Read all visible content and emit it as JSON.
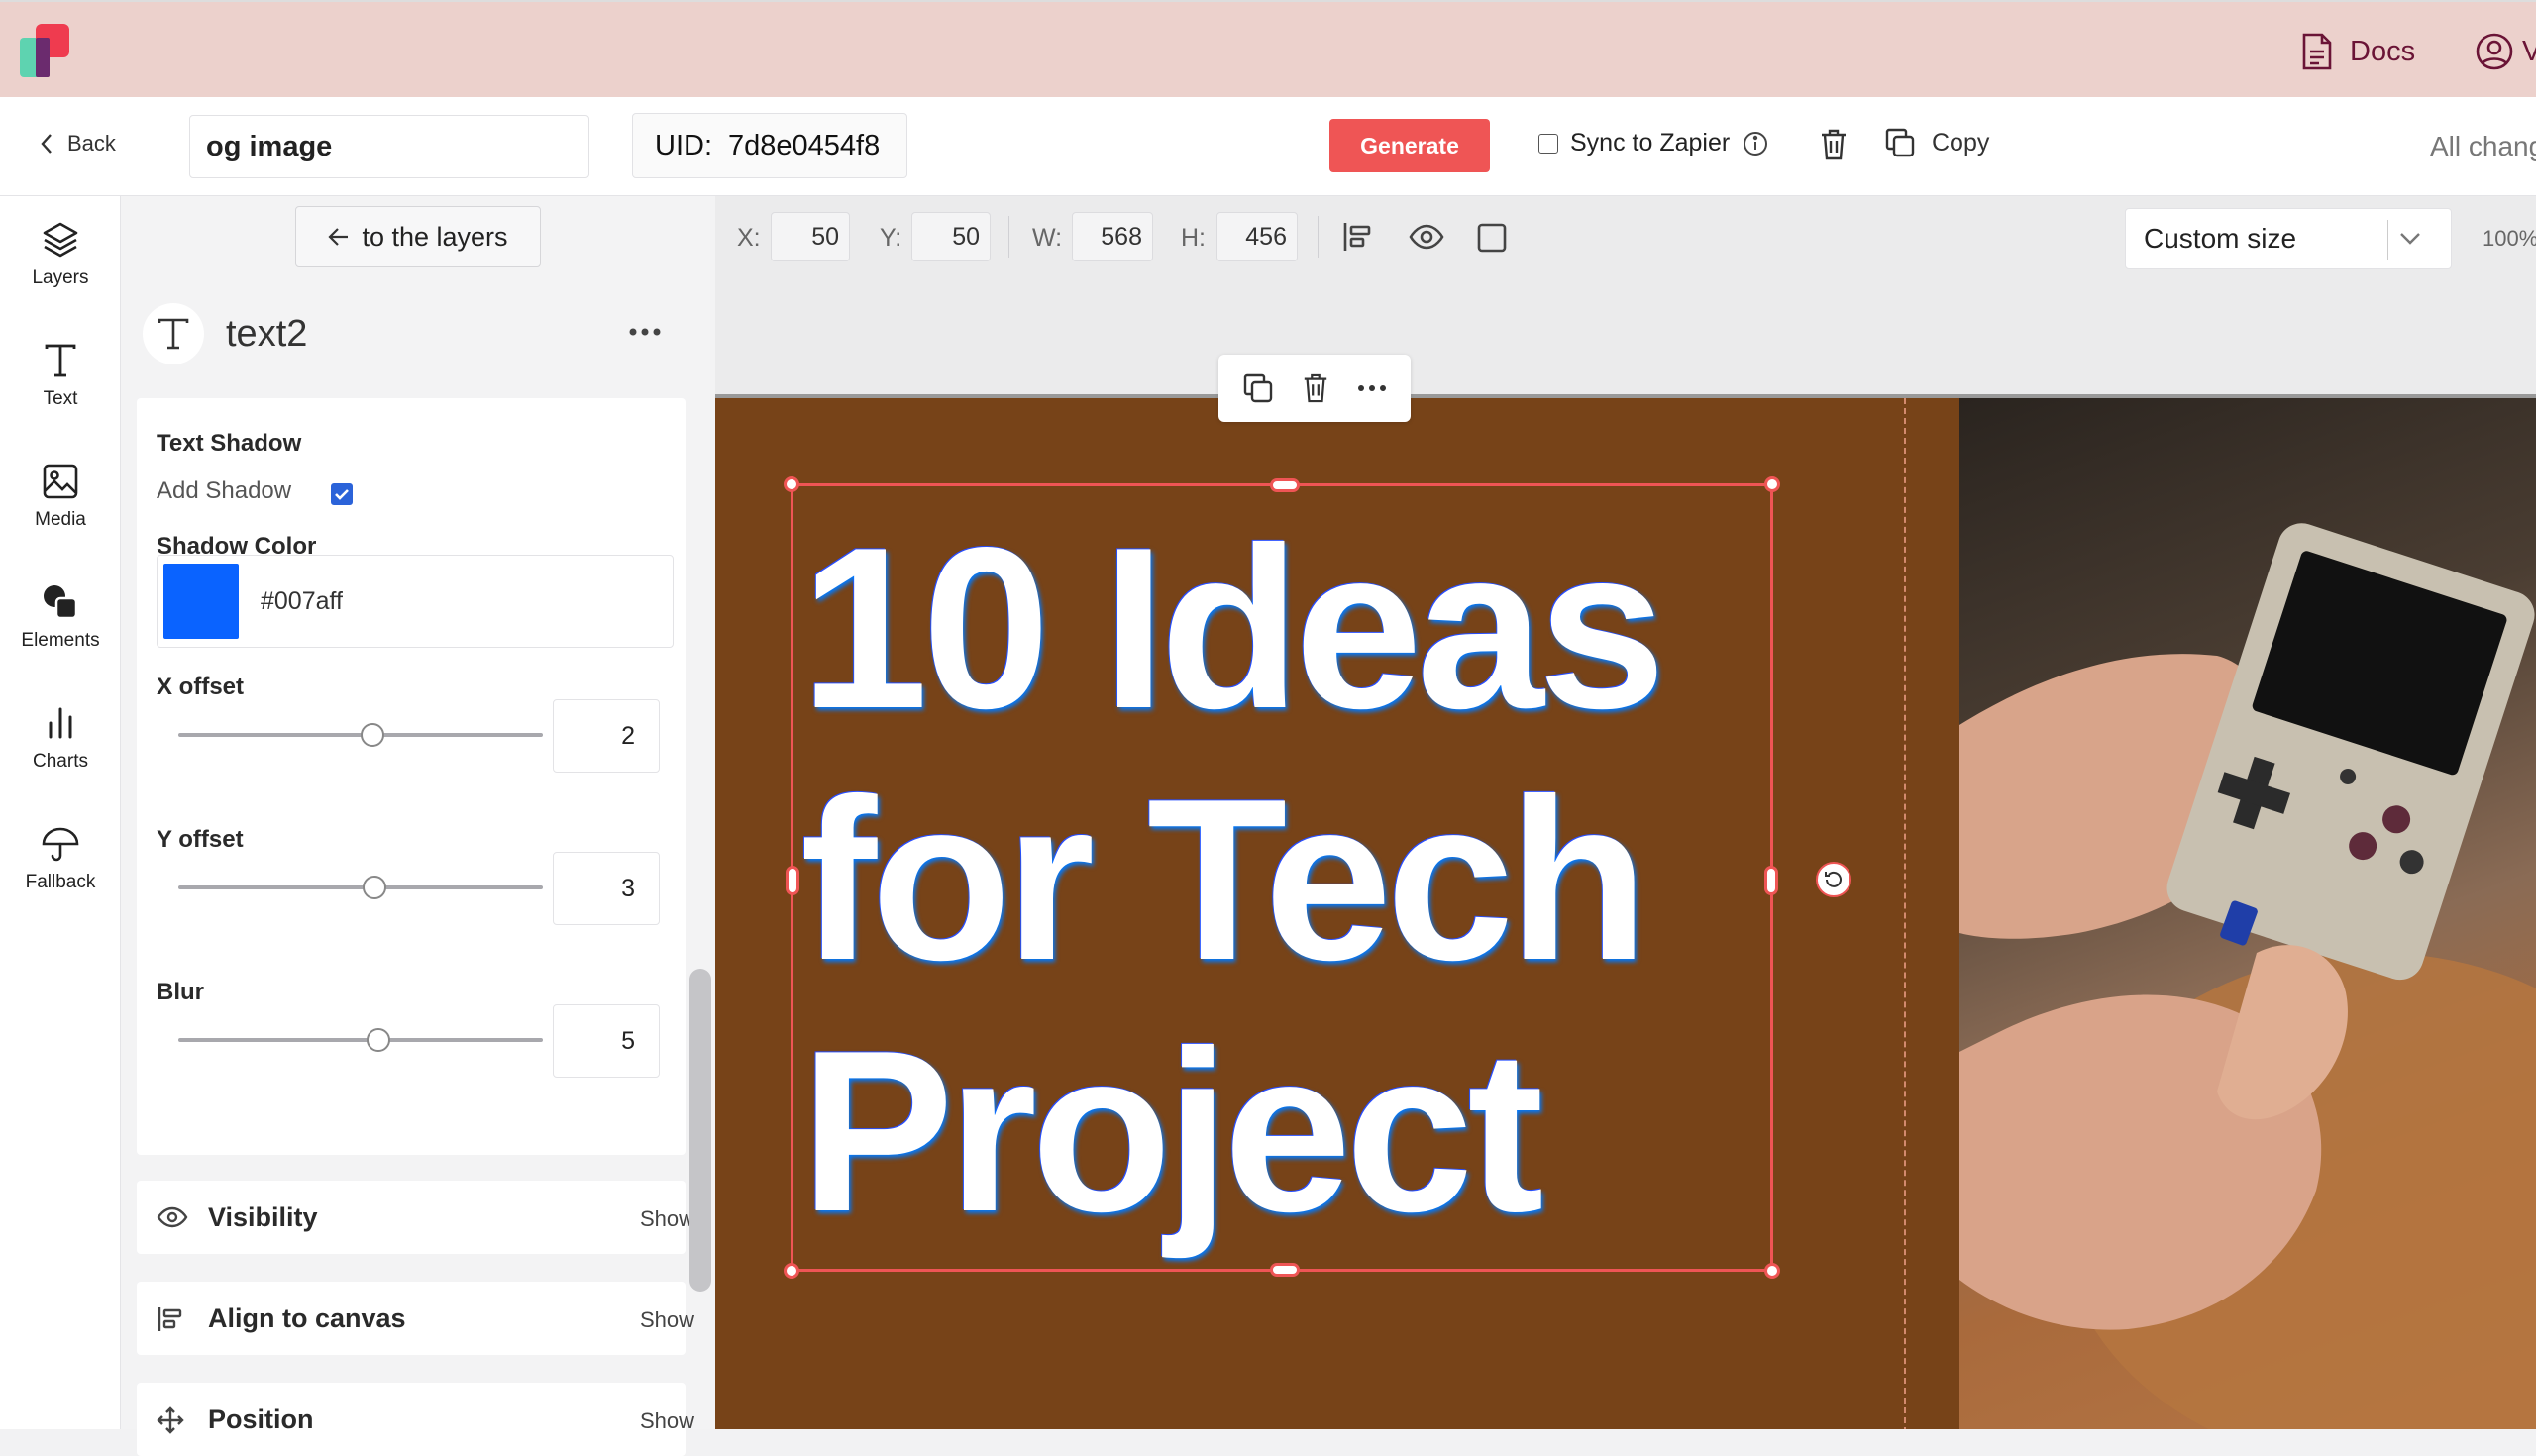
{
  "header": {
    "docs_label": "Docs",
    "account_initial": "V"
  },
  "toolbar": {
    "back_label": "Back",
    "template_name": "og image",
    "uid_label": "UID:",
    "uid_value": "7d8e0454f8",
    "generate_label": "Generate",
    "sync_label": "Sync to Zapier",
    "sync_checked": false,
    "copy_label": "Copy",
    "status_text": "All chang"
  },
  "nav": {
    "items": [
      {
        "label": "Layers",
        "icon": "layers-icon"
      },
      {
        "label": "Text",
        "icon": "text-icon"
      },
      {
        "label": "Media",
        "icon": "image-icon"
      },
      {
        "label": "Elements",
        "icon": "shapes-icon"
      },
      {
        "label": "Charts",
        "icon": "bar-chart-icon"
      },
      {
        "label": "Fallback",
        "icon": "umbrella-icon"
      }
    ]
  },
  "panel": {
    "back_to_layers": "to the layers",
    "layer_name": "text2",
    "text_shadow_title": "Text Shadow",
    "add_shadow_label": "Add Shadow",
    "add_shadow_checked": true,
    "shadow_color_label": "Shadow Color",
    "shadow_color": "#007aff",
    "x_offset_label": "X offset",
    "x_offset_value": "2",
    "y_offset_label": "Y offset",
    "y_offset_value": "3",
    "blur_label": "Blur",
    "blur_value": "5",
    "sections": [
      {
        "label": "Visibility",
        "action": "Show",
        "icon": "eye-icon"
      },
      {
        "label": "Align to canvas",
        "action": "Show",
        "icon": "align-left-icon"
      },
      {
        "label": "Position",
        "action": "Show",
        "icon": "move-icon"
      }
    ]
  },
  "canvas": {
    "x_label": "X:",
    "x_value": "50",
    "y_label": "Y:",
    "y_value": "50",
    "w_label": "W:",
    "w_value": "568",
    "h_label": "H:",
    "h_value": "456",
    "size_option": "Custom size",
    "zoom": "100%",
    "headline_lines": [
      "10 Ideas",
      "for Tech",
      "Project"
    ],
    "background_color": "#774318",
    "selection_color": "#ef5555"
  }
}
